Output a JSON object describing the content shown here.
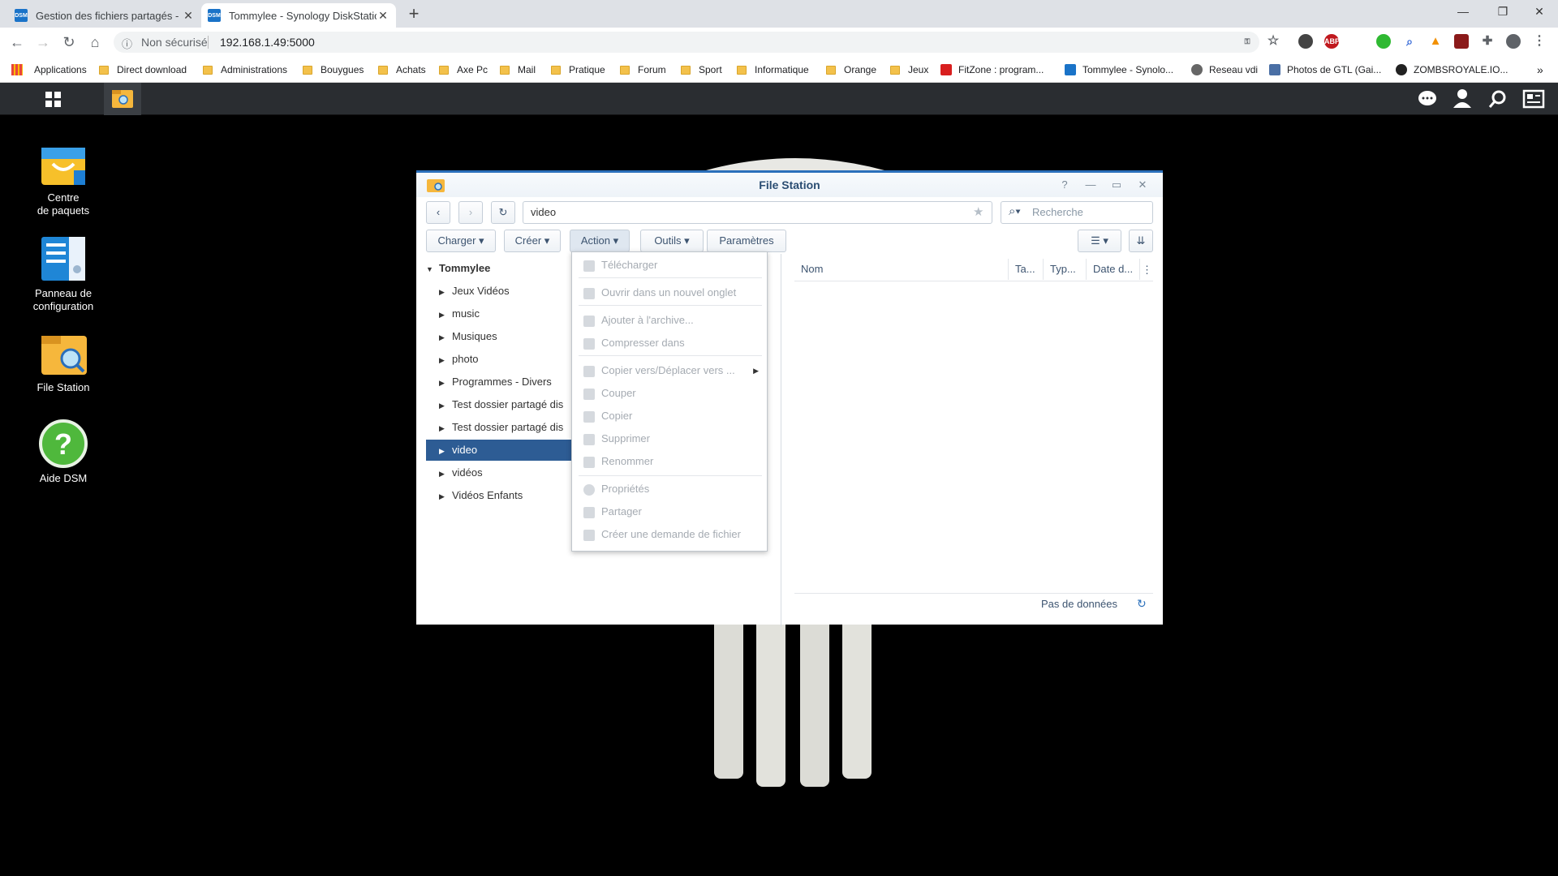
{
  "browser": {
    "tabs": [
      {
        "favicon": "DSM",
        "title": "Gestion des fichiers partagés - Pa"
      },
      {
        "favicon": "DSM",
        "title": "Tommylee - Synology DiskStation"
      }
    ],
    "new_tab": "+",
    "address": {
      "security_label": "Non sécurisé",
      "url": "192.168.1.49:5000"
    },
    "bookmarks": [
      "Applications",
      "Direct download",
      "Administrations",
      "Bouygues",
      "Achats",
      "Axe Pc",
      "Mail",
      "Pratique",
      "Forum",
      "Sport",
      "Informatique",
      "Orange",
      "Jeux",
      "FitZone : program...",
      "Tommylee - Synolo...",
      "Reseau vdi",
      "Photos de GTL (Gai...",
      "ZOMBSROYALE.IO..."
    ],
    "extensions": [
      {
        "name": "key-icon",
        "label": "",
        "color": "#5f6368"
      },
      {
        "name": "star-icon",
        "label": "",
        "color": "#5f6368"
      },
      {
        "name": "extension-dark-icon",
        "label": "",
        "color": "#444444"
      },
      {
        "name": "adblock-icon",
        "label": "ABP",
        "color": "#c0181e"
      },
      {
        "name": "green-circle-icon",
        "label": "",
        "color": "#2fb932"
      },
      {
        "name": "search-ext-icon",
        "label": "",
        "color": "#3367d6"
      },
      {
        "name": "warning-ext-icon",
        "label": "",
        "color": "#f29000"
      },
      {
        "name": "pdf-icon",
        "label": "",
        "color": "#8b1a1a"
      },
      {
        "name": "puzzle-icon",
        "label": "",
        "color": "#5f6368"
      },
      {
        "name": "profile-icon",
        "label": "",
        "color": "#5f6368"
      },
      {
        "name": "menu-icon",
        "label": "",
        "color": "#5f6368"
      }
    ]
  },
  "desktop": {
    "icons": [
      {
        "label1": "Centre",
        "label2": "de paquets"
      },
      {
        "label1": "Panneau de",
        "label2": "configuration"
      },
      {
        "label1": "File Station",
        "label2": ""
      },
      {
        "label1": "Aide DSM",
        "label2": ""
      }
    ]
  },
  "window": {
    "title": "File Station",
    "path": "video",
    "search_placeholder": "Recherche",
    "toolbar": [
      "Charger",
      "Créer",
      "Action",
      "Outils",
      "Paramètres"
    ],
    "tree_root": "Tommylee",
    "tree": [
      "Jeux Vidéos",
      "music",
      "Musiques",
      "photo",
      "Programmes - Divers",
      "Test dossier partagé dis",
      "Test dossier partagé dis",
      "video",
      "vidéos",
      "Vidéos Enfants"
    ],
    "selected_index": 7,
    "columns": [
      "Nom",
      "Ta...",
      "Typ...",
      "Date d..."
    ],
    "status": "Pas de données"
  },
  "action_menu": {
    "items": [
      {
        "label": "Télécharger"
      },
      {
        "label": "Ouvrir dans un nouvel onglet"
      },
      {
        "label": "Ajouter à l'archive..."
      },
      {
        "label": "Compresser dans"
      },
      {
        "label": "Copier vers/Déplacer vers ..."
      },
      {
        "label": "Couper"
      },
      {
        "label": "Copier"
      },
      {
        "label": "Supprimer"
      },
      {
        "label": "Renommer"
      },
      {
        "label": "Propriétés"
      },
      {
        "label": "Partager"
      },
      {
        "label": "Créer une demande de fichier"
      }
    ]
  }
}
